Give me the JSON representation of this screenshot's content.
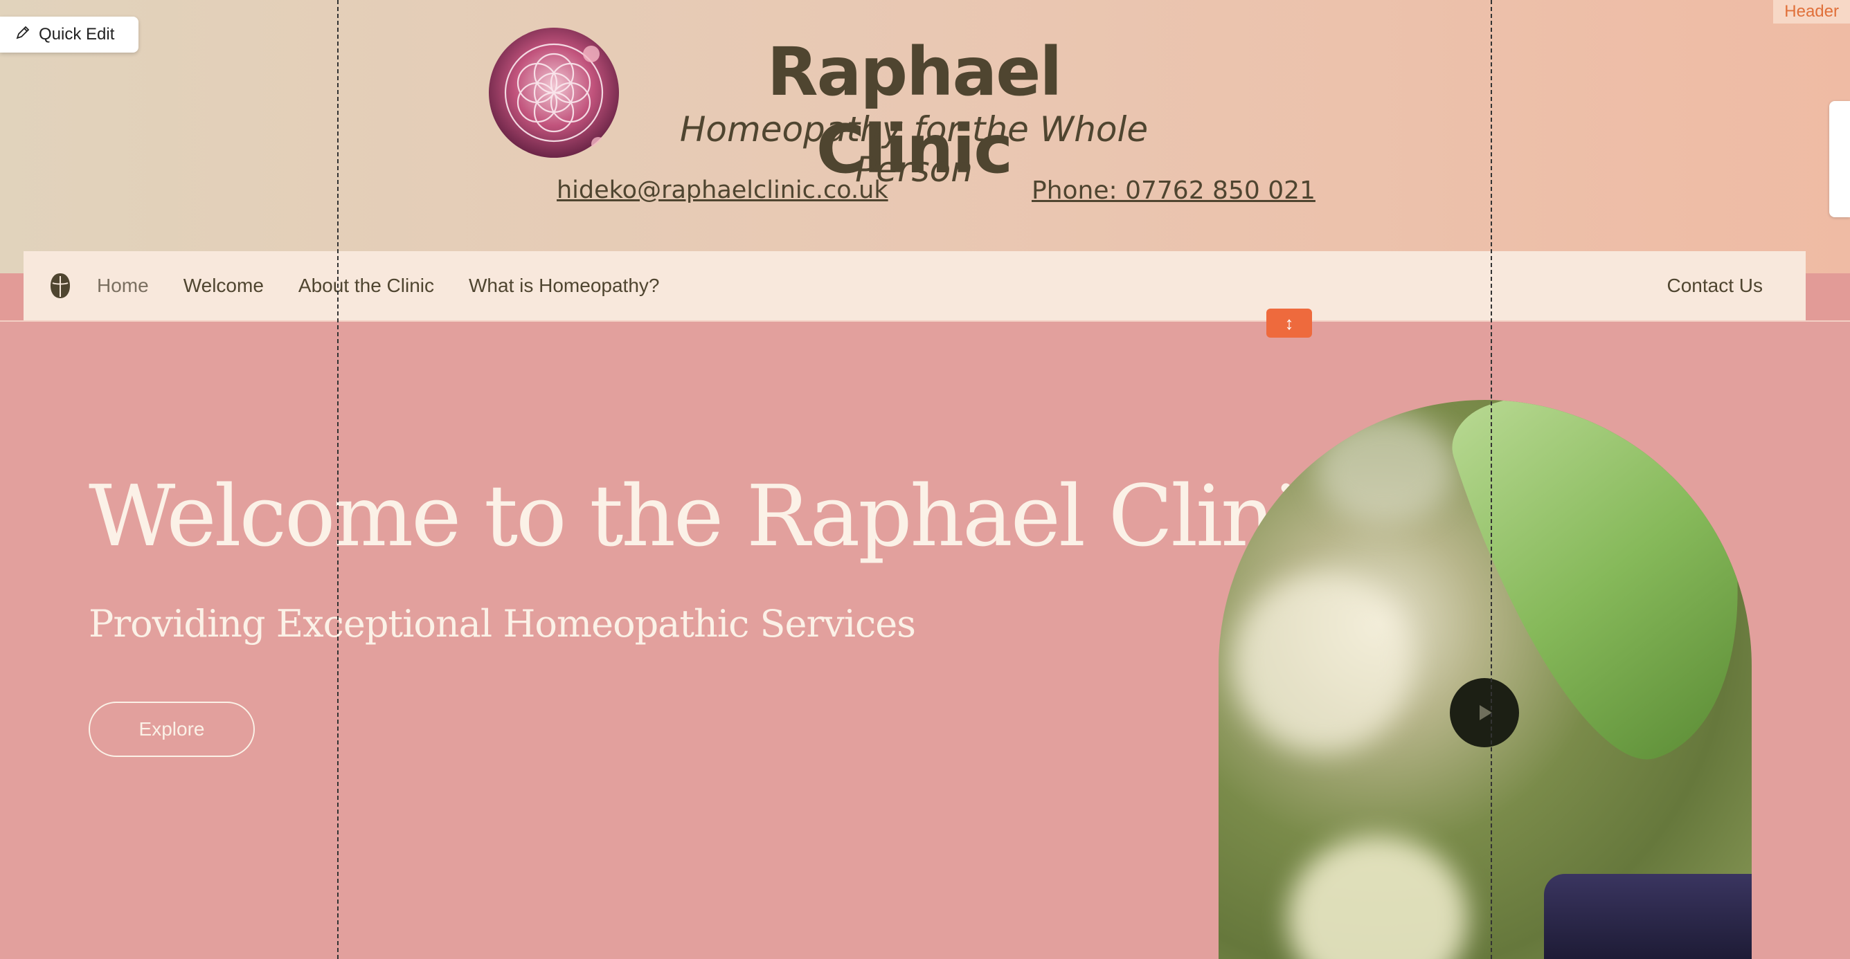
{
  "editor": {
    "quick_edit_label": "Quick Edit",
    "header_tag": "Header"
  },
  "header": {
    "title": "Raphael Clinic",
    "subtitle": "Homeopathy for the Whole Person",
    "email": "hideko@raphaelclinic.co.uk",
    "phone": "Phone: 07762 850 021"
  },
  "nav": {
    "items": [
      {
        "label": "Home"
      },
      {
        "label": "Welcome"
      },
      {
        "label": "About the Clinic"
      },
      {
        "label": "What is Homeopathy?"
      }
    ],
    "contact_label": "Contact Us"
  },
  "hero": {
    "title": "Welcome to the Raphael Clinic",
    "subtitle": "Providing Exceptional Homeopathic Services",
    "cta_label": "Explore"
  },
  "colors": {
    "hero_bg": "#e2a09d",
    "text_dark": "#4f4530",
    "accent_orange": "#ee6a3d",
    "hero_text": "#fbf1e7"
  },
  "icons": [
    "pencil-icon",
    "nav-logo-icon",
    "resize-vertical-icon",
    "play-icon"
  ]
}
